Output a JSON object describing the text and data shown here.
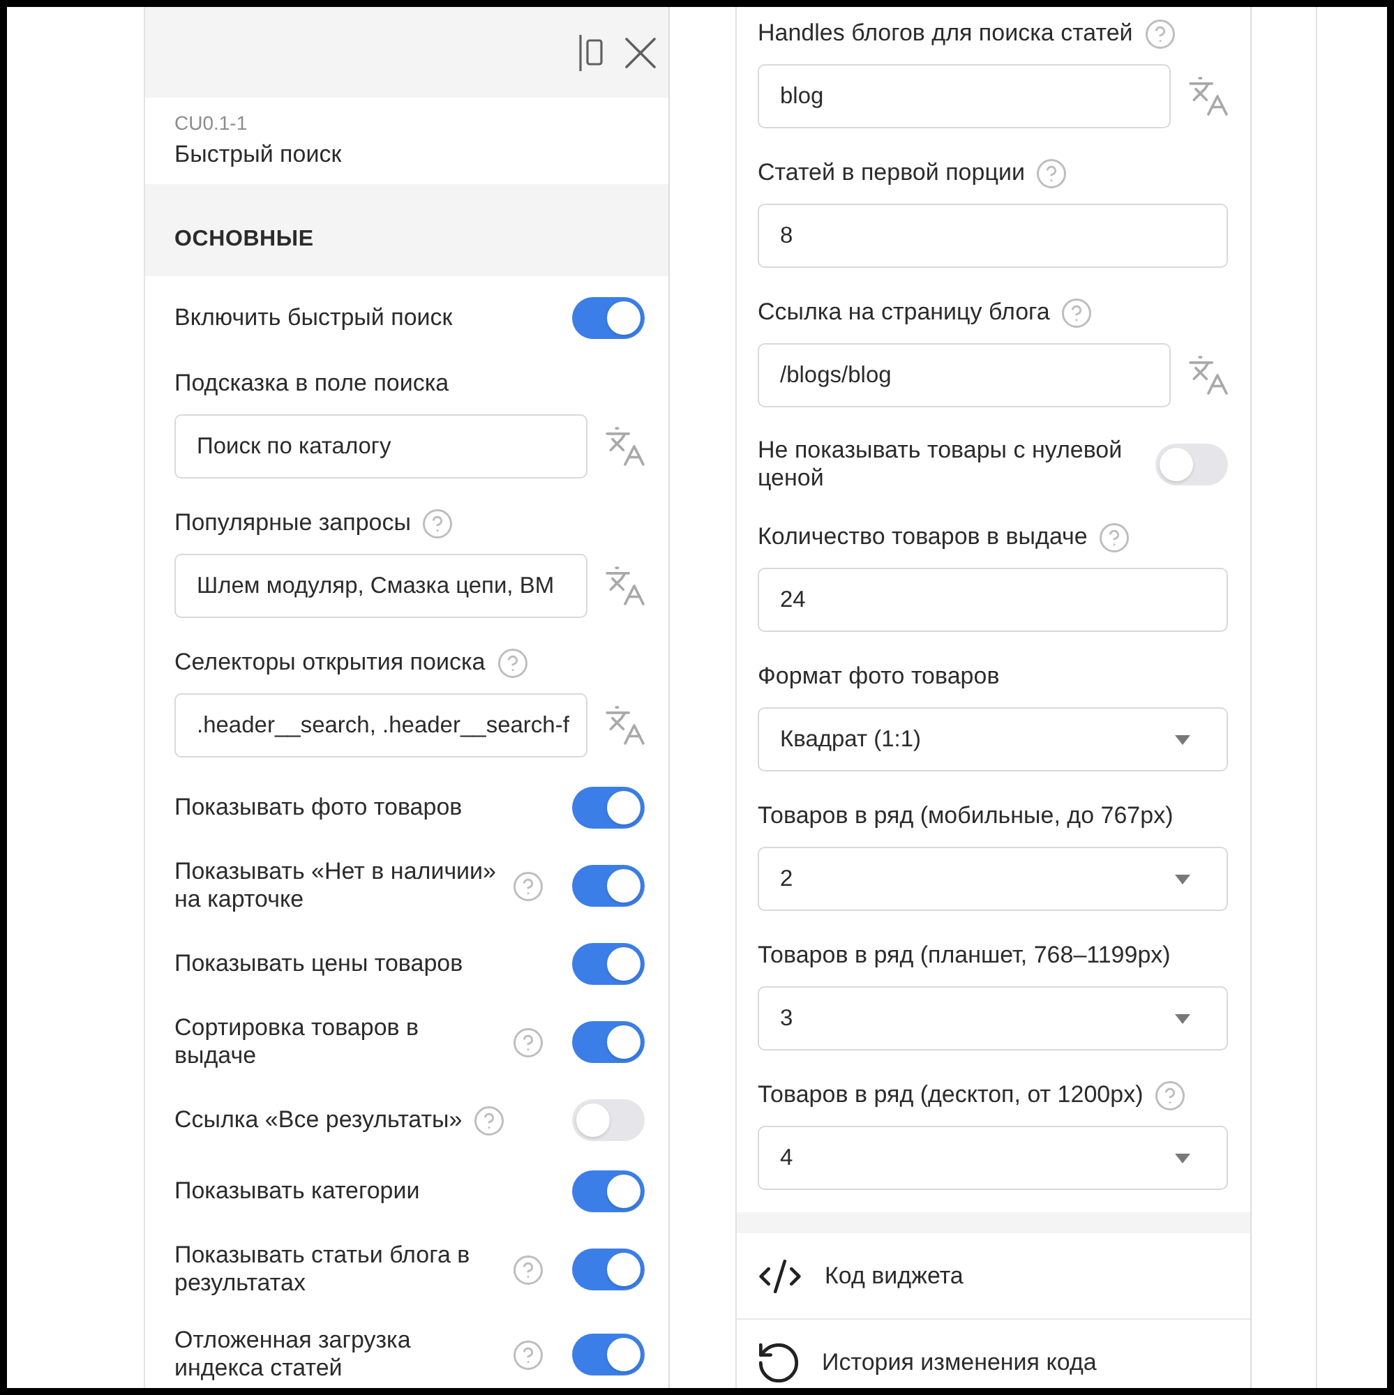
{
  "left_panel": {
    "widget": {
      "code": "CU0.1-1",
      "name": "Быстрый поиск"
    },
    "section_title": "ОСНОВНЫЕ",
    "settings": [
      {
        "kind": "toggle",
        "label": "Включить быстрый поиск",
        "help": false,
        "on": true
      },
      {
        "kind": "input",
        "label": "Подсказка в поле поиска",
        "help": false,
        "value": "Поиск по каталогу",
        "translatable": true
      },
      {
        "kind": "input",
        "label": "Популярные запросы",
        "help": true,
        "value": "Шлем модуляр, Смазка цепи, BM",
        "translatable": true
      },
      {
        "kind": "input",
        "label": "Селекторы открытия поиска",
        "help": true,
        "value": ".header__search, .header__search-f",
        "translatable": true
      },
      {
        "kind": "toggle",
        "label": "Показывать фото товаров",
        "help": false,
        "on": true
      },
      {
        "kind": "toggle",
        "label": "Показывать «Нет в наличии» на карточке",
        "help": true,
        "on": true
      },
      {
        "kind": "toggle",
        "label": "Показывать цены товаров",
        "help": false,
        "on": true
      },
      {
        "kind": "toggle",
        "label": "Сортировка товаров в выдаче",
        "help": true,
        "on": true
      },
      {
        "kind": "toggle",
        "label": "Ссылка «Все результаты»",
        "help": true,
        "on": false
      },
      {
        "kind": "toggle",
        "label": "Показывать категории",
        "help": false,
        "on": true
      },
      {
        "kind": "toggle",
        "label": "Показывать статьи блога в результатах",
        "help": true,
        "on": true
      },
      {
        "kind": "toggle",
        "label": "Отложенная загрузка индекса статей",
        "help": true,
        "on": true
      }
    ]
  },
  "right_panel": {
    "settings": [
      {
        "kind": "input",
        "label": "Handles блогов для поиска статей",
        "help": true,
        "value": "blog",
        "translatable": true
      },
      {
        "kind": "input",
        "label": "Статей в первой порции",
        "help": true,
        "value": "8",
        "translatable": false
      },
      {
        "kind": "input",
        "label": "Ссылка на страницу блога",
        "help": true,
        "value": "/blogs/blog",
        "translatable": true
      },
      {
        "kind": "toggle",
        "label": "Не показывать товары с нулевой ценой",
        "help": false,
        "on": false
      },
      {
        "kind": "input",
        "label": "Количество товаров в выдаче",
        "help": true,
        "value": "24",
        "translatable": false
      },
      {
        "kind": "select",
        "label": "Формат фото товаров",
        "help": false,
        "value": "Квадрат (1:1)"
      },
      {
        "kind": "select",
        "label": "Товаров в ряд (мобильные, до 767px)",
        "help": false,
        "value": "2"
      },
      {
        "kind": "select",
        "label": "Товаров в ряд (планшет, 768–1199px)",
        "help": false,
        "value": "3"
      },
      {
        "kind": "select",
        "label": "Товаров в ряд (десктоп, от 1200px)",
        "help": true,
        "value": "4"
      }
    ],
    "actions": [
      {
        "kind": "code",
        "label": "Код виджета"
      },
      {
        "kind": "history",
        "label": "История изменения кода"
      }
    ]
  }
}
